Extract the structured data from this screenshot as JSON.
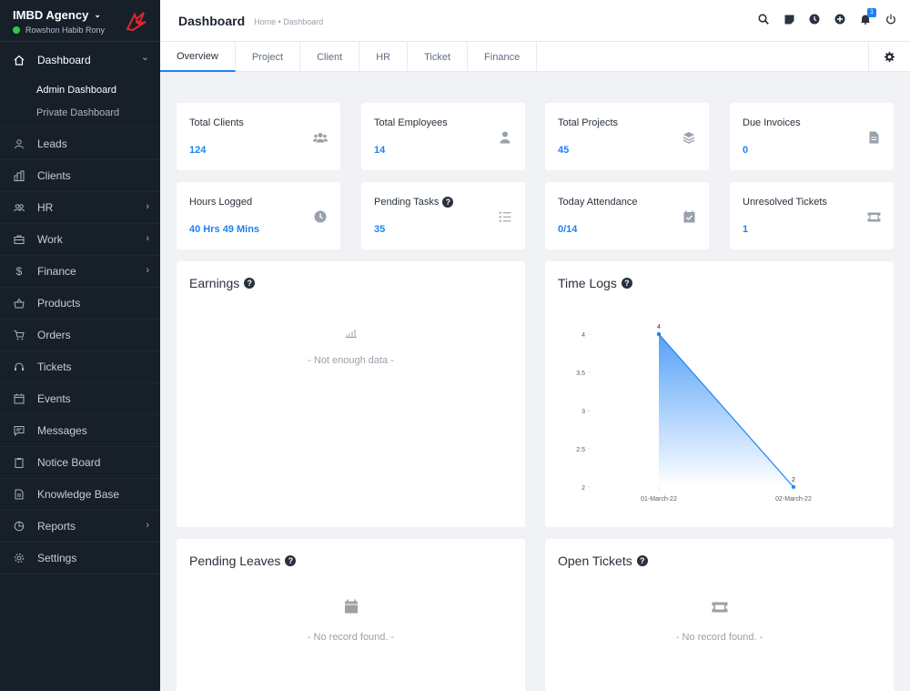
{
  "brand": {
    "name": "IMBD Agency",
    "user": "Rowshon Habib Rony"
  },
  "sidebar": {
    "dashboard_label": "Dashboard",
    "sub_items": [
      "Admin Dashboard",
      "Private Dashboard"
    ],
    "items": [
      {
        "label": "Leads",
        "icon": "user-icon"
      },
      {
        "label": "Clients",
        "icon": "building-icon"
      },
      {
        "label": "HR",
        "icon": "users-icon",
        "arrow": true
      },
      {
        "label": "Work",
        "icon": "briefcase-icon",
        "arrow": true
      },
      {
        "label": "Finance",
        "icon": "dollar-icon",
        "arrow": true
      },
      {
        "label": "Products",
        "icon": "basket-icon"
      },
      {
        "label": "Orders",
        "icon": "cart-icon"
      },
      {
        "label": "Tickets",
        "icon": "headset-icon"
      },
      {
        "label": "Events",
        "icon": "calendar-icon"
      },
      {
        "label": "Messages",
        "icon": "message-icon"
      },
      {
        "label": "Notice Board",
        "icon": "clipboard-icon"
      },
      {
        "label": "Knowledge Base",
        "icon": "document-icon"
      },
      {
        "label": "Reports",
        "icon": "pie-chart-icon",
        "arrow": true
      },
      {
        "label": "Settings",
        "icon": "gear-icon"
      }
    ]
  },
  "header": {
    "title": "Dashboard",
    "breadcrumb": "Home • Dashboard",
    "notification_count": "1"
  },
  "tabs": [
    "Overview",
    "Project",
    "Client",
    "HR",
    "Ticket",
    "Finance"
  ],
  "stats": [
    {
      "title": "Total Clients",
      "value": "124",
      "icon": "users-icon"
    },
    {
      "title": "Total Employees",
      "value": "14",
      "icon": "user-icon"
    },
    {
      "title": "Total Projects",
      "value": "45",
      "icon": "layers-icon"
    },
    {
      "title": "Due Invoices",
      "value": "0",
      "icon": "invoice-icon"
    },
    {
      "title": "Hours Logged",
      "value": "40 Hrs 49 Mins",
      "icon": "clock-icon"
    },
    {
      "title": "Pending Tasks",
      "value": "35",
      "icon": "tasks-icon",
      "help": true
    },
    {
      "title": "Today Attendance",
      "value": "0/14",
      "icon": "calendar-check-icon"
    },
    {
      "title": "Unresolved Tickets",
      "value": "1",
      "icon": "ticket-icon"
    }
  ],
  "panels": {
    "earnings": {
      "title": "Earnings",
      "empty": "- Not enough data -"
    },
    "time_logs": {
      "title": "Time Logs"
    },
    "pending_leaves": {
      "title": "Pending Leaves",
      "empty": "- No record found. -"
    },
    "open_tickets": {
      "title": "Open Tickets",
      "empty": "- No record found. -"
    }
  },
  "chart_data": {
    "type": "area",
    "x": [
      "01-March-22",
      "02-March-22"
    ],
    "series": [
      {
        "values": [
          4,
          2
        ]
      }
    ],
    "y_ticks": [
      "2",
      "2.5",
      "3",
      "3.5",
      "4"
    ],
    "ylim": [
      2,
      4
    ],
    "color": "#1d82f5"
  }
}
